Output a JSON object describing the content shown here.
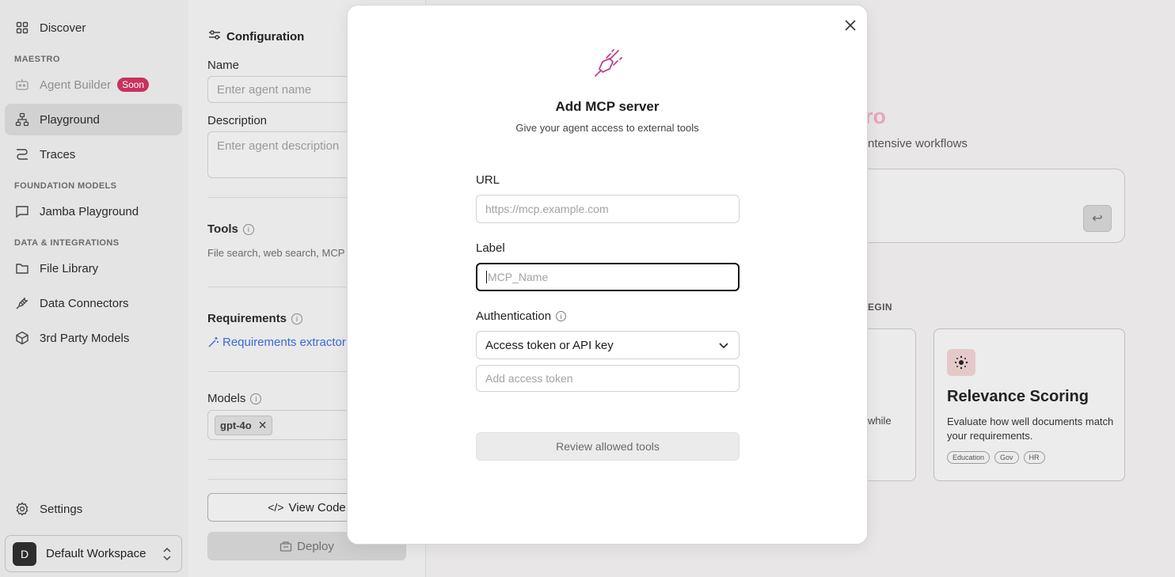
{
  "sidebar": {
    "discover": "Discover",
    "section_maestro": "MAESTRO",
    "agent_builder": "Agent Builder",
    "soon_badge": "Soon",
    "playground": "Playground",
    "traces": "Traces",
    "section_foundation": "FOUNDATION MODELS",
    "jamba": "Jamba Playground",
    "section_data": "DATA & INTEGRATIONS",
    "file_library": "File Library",
    "data_connectors": "Data Connectors",
    "third_party": "3rd Party Models",
    "settings": "Settings",
    "workspace_initial": "D",
    "workspace_name": "Default Workspace"
  },
  "config": {
    "title": "Configuration",
    "name_label": "Name",
    "name_placeholder": "Enter agent name",
    "description_label": "Description",
    "description_placeholder": "Enter agent description",
    "tools_label": "Tools",
    "tools_hint": "File search, web search, MCP c",
    "requirements_label": "Requirements",
    "requirements_link": "Requirements extractor",
    "models_label": "Models",
    "model_chip": "gpt-4o",
    "view_code": "View Code",
    "deploy": "Deploy"
  },
  "background": {
    "title_fragment": "ro",
    "subtitle_fragment": "ntensive workflows",
    "section_fragment": "EGIN",
    "card_left_fragment": "while",
    "card_title": "Relevance Scoring",
    "card_desc": "Evaluate how well documents match your requirements.",
    "tags": [
      "Education",
      "Gov",
      "HR"
    ]
  },
  "modal": {
    "title": "Add MCP server",
    "subtitle": "Give your agent access to external tools",
    "url_label": "URL",
    "url_placeholder": "https://mcp.example.com",
    "label_label": "Label",
    "label_placeholder": "MCP_Name",
    "auth_label": "Authentication",
    "auth_selected": "Access token or API key",
    "token_placeholder": "Add access token",
    "review_button": "Review allowed tools"
  },
  "colors": {
    "accent_pink": "#c8325d",
    "link_blue": "#3a6ad6",
    "plug_icon": "#c0408a"
  }
}
